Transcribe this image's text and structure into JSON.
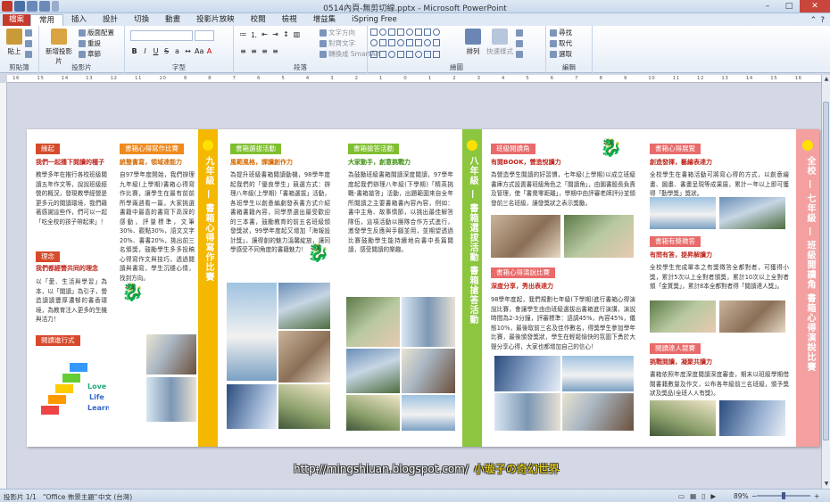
{
  "window": {
    "title": "0514內頁-無剪切線.pptx - Microsoft PowerPoint",
    "controls": [
      "–",
      "□",
      "✕"
    ]
  },
  "tabs": [
    {
      "label": "檔案"
    },
    {
      "label": "常用"
    },
    {
      "label": "插入"
    },
    {
      "label": "設計"
    },
    {
      "label": "切換"
    },
    {
      "label": "動畫"
    },
    {
      "label": "投影片放映"
    },
    {
      "label": "校閱"
    },
    {
      "label": "檢視"
    },
    {
      "label": "增益集"
    },
    {
      "label": "iSpring Free"
    }
  ],
  "ribbon": {
    "clipboard": {
      "label": "剪貼簿",
      "paste": "貼上",
      "cut": "剪下",
      "copy": "複製",
      "painter": "格式"
    },
    "slides": {
      "label": "投影片",
      "new_slide": "新增投影片",
      "layout": "版面配置",
      "reset": "重設",
      "section": "章節"
    },
    "font": {
      "label": "字型"
    },
    "paragraph": {
      "label": "段落",
      "text_dir": "文字方向",
      "align_text": "對齊文字",
      "smartart": "轉換成 SmartArt"
    },
    "drawing": {
      "label": "繪圖",
      "arrange": "排列",
      "quick_styles": "快速樣式",
      "fill": "圖案填滿",
      "outline": "圖案外框",
      "effects": "圖案效果"
    },
    "editing": {
      "label": "編輯",
      "find": "尋找",
      "replace": "取代",
      "select": "選取"
    }
  },
  "ruler_numbers": [
    "16",
    "15",
    "14",
    "13",
    "12",
    "11",
    "10",
    "9",
    "8",
    "7",
    "6",
    "5",
    "4",
    "3",
    "2",
    "1",
    "0",
    "1",
    "2",
    "3",
    "4",
    "5",
    "6",
    "7",
    "8",
    "9",
    "10",
    "11",
    "12",
    "13",
    "14",
    "15",
    "16"
  ],
  "slide": {
    "col1": {
      "lbl1": "緣起",
      "sub1": "我們一起播下閱讀的種子",
      "body1": "教學多年在推行各校班級閱讀五年作文等，說說班級經營的概況，發現教學經營是更多元的閱讀環境，我們藉著感謝這些作，們可以一起「吃全校的孩子帶起來」！",
      "lbl2": "理念",
      "sub2": "我們都經營共同的理念",
      "body2": "以「愛、生活與學習」為本，以「閱讀」為引子，營造讀讀豐厚濃郁的書香環境，為教育注入更多的生機與活力！",
      "lbl3": "閱讀進行式",
      "stair_words": [
        "Love",
        "Life",
        "Learn"
      ]
    },
    "col2": {
      "lbl": "書箱心得寫作比賽",
      "sub": "統整書寫，領域達能力",
      "body": "自97學年度開始，我們辦理九年級(上學期)書箱心得寫作比賽，讓學生在最有前前所學兩週看一篇，大家挑選書籍中最喜的書寫下高深的感動，評量標準，文筆30%、觀點30%，語文文字20%、書書20%，挑出前三名頒獎，鼓勵學生多多投稿心得寫作文與技巧，透過閱讀與書寫，學生沉穩心情，找到方向。"
    },
    "band1": "九年級 — 書箱心得寫作比賽",
    "col3": {
      "lbl": "書箱選拔活動",
      "sub": "風範風格，譯讀創作力",
      "body": "為提升班級書箱閱讀動機，98學年度起我們的「優良學生」競選方式：辦理八年級(上學期)「書箱選拔」活動，各班學生以創意編劇發表書方式介紹書箱書籍內容，同學票選出最受歡迎的三本書，鼓勵教育的前五名班級頒發獎狀，99學年度起又增加「海報設計獎」，讓得創的魅力溫馨綻放，讓同學感受不同角度的書籍魅力！"
    },
    "col4": {
      "lbl": "書箱搶答活動",
      "sub": "大家動手，創意挑戰力",
      "body": "為鼓勵班級書箱閱讀深度閱讀，97學年度起我們辦理八年級(下學期)「精英挑戰-書箱搶答」活動，出題範圍來自全年所閱讀之主要書箱書內容內容，例如：書中主角、故事情節，以挑出最佳解答隊伍，這項活動以團隊合作方式進行，激發學生反應與手腦並用，並期望透過比賽鼓勵學生能持續地向書中長篇閱讀，感受閱讀的樂趣。"
    },
    "band2": "八年級 — 書箱選拔活動  書箱搶答活動",
    "col5": {
      "lbl1": "班級閱讀角",
      "sub1": "有閱BOOK，營造悅讀力",
      "body1": "為營造學生閱讀的好習慣，七年級(上學期)以成立班級書庫方式設置書班級角色之「閱讀角」，由圖書股長負責及管理，使「書覺零距離」，學期中由評審老師評分並頒發前三名班級，讓發獎狀之表示獎勵。",
      "lbl2": "書箱心得演說比賽",
      "sub2": "深度分享，秀出表達力",
      "body2": "98學年度起，我們規劃七年級(下學期)進行書箱心得演說比賽，會讓學生由由班級選拔出書箱進行演講，演說時間為2-3分鐘，評審標準：語調45%，內容45%，儀態10%，最後取前三名及佳作數名，得獎學生參加學年比賽，最後頒發獎狀，學生在輕鬆愉快的氛圍下勇於大聲分享心得，大家也都增加自己的信心！"
    },
    "col6": {
      "lbl1": "書箱心得展覽",
      "sub1": "創造發揮，藝繪表達力",
      "body1": "全校學生在書箱活動可將寫心得的方式，以創意繪畫、圖畫、書畫呈現等成果展，累計一年以上即可獲得「勤學獎」獎狀。",
      "lbl2": "書箱有獎徵答",
      "sub2": "有問有答，提昇解讀力",
      "body2": "全校學生完成單本之有獎徵答全都對者，可獲得小獎，累計5次以上全對者頒獎，累計10次以上全對者頒「金質獎」，累計8本全都對者得「閱讀達人獎」。",
      "lbl3": "閱讀達人競賽",
      "sub3": "挑戰閱讀，凝聚共讀力",
      "body3": "書箱依照年度深度閱讀深度審查，期末以班級學期借閱書籍數量及作文，公布各年級前三名班級，頒予獎狀及獎品(全班人人有獎)。"
    },
    "band3": "全校 — 七年級 — 班級閱讀角  書箱心得演說比賽"
  },
  "watermark": {
    "url": "http://mingshiuan.blogspot.com/",
    "caption": "小璇子の奇幻世界"
  },
  "status": {
    "slide_no": "投影片 1/1",
    "theme": "\"Office 佈景主題\"",
    "lang": "中文 (台灣)",
    "zoom": "89%"
  }
}
